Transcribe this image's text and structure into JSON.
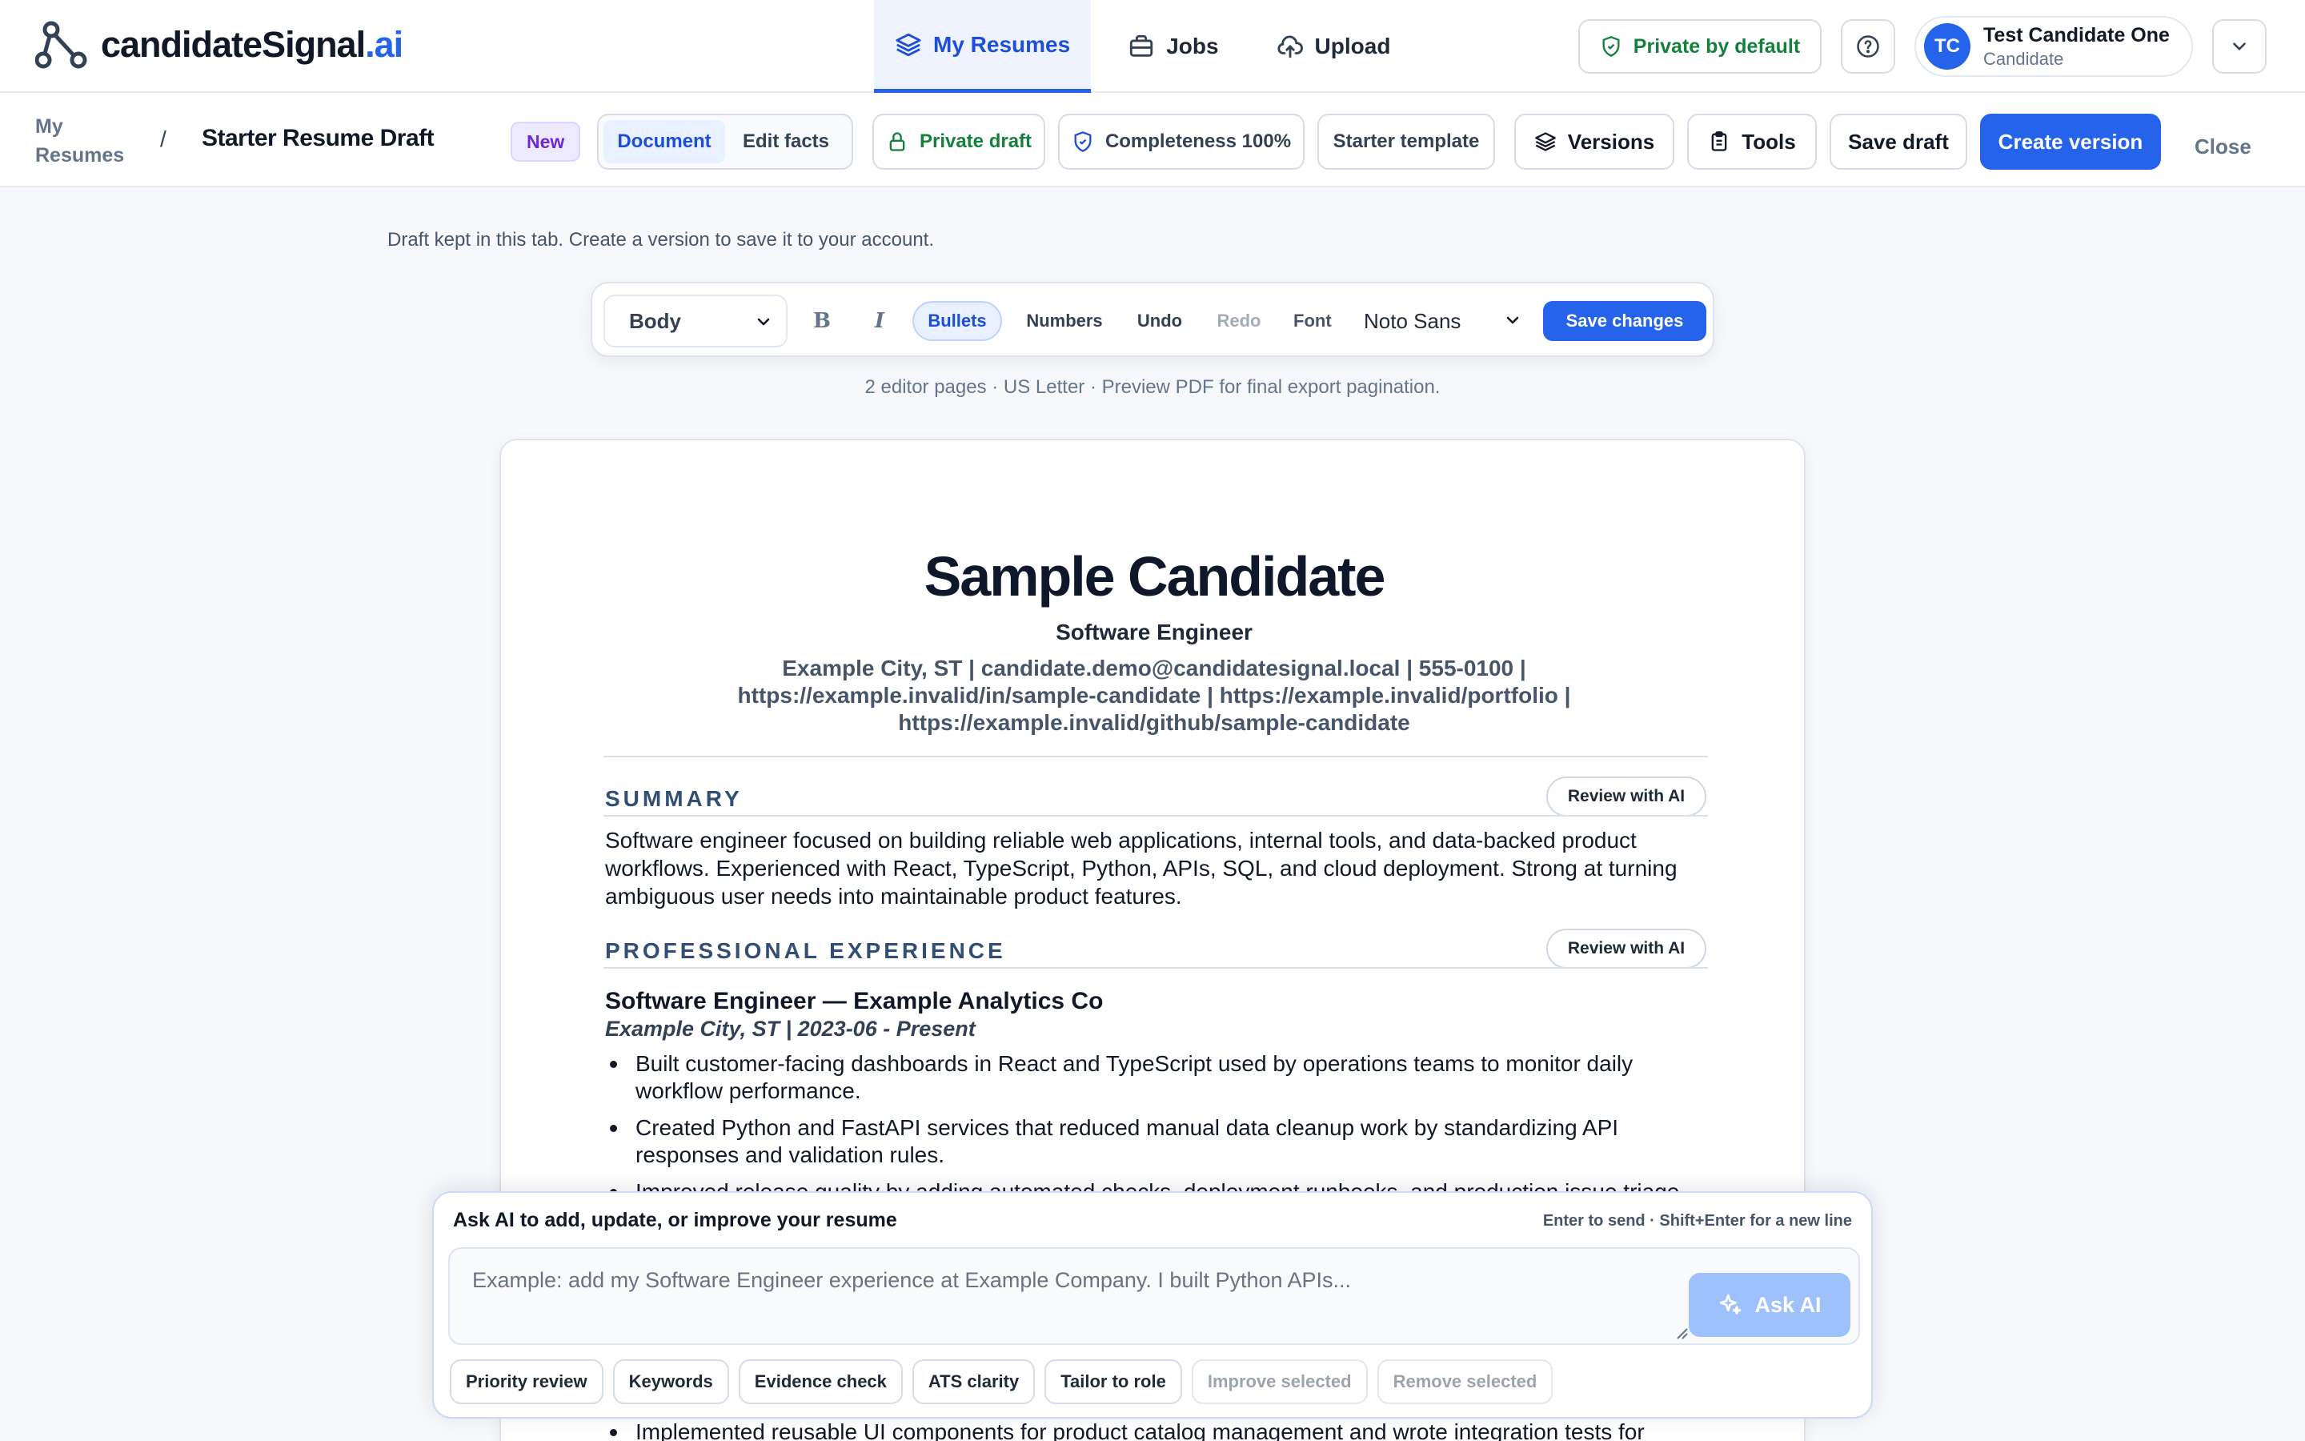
{
  "brand": {
    "name": "candidateSignal",
    "suffix": ".ai"
  },
  "nav": {
    "tabs": [
      {
        "label": "My Resumes",
        "icon": "layers-icon",
        "active": true
      },
      {
        "label": "Jobs",
        "icon": "briefcase-icon",
        "active": false
      },
      {
        "label": "Upload",
        "icon": "cloud-upload-icon",
        "active": false
      }
    ],
    "privacy_label": "Private by default",
    "help_icon": "help-circle-icon"
  },
  "user": {
    "initials": "TC",
    "name": "Test Candidate One",
    "role": "Candidate"
  },
  "toolbar": {
    "breadcrumb_root": "My Resumes",
    "breadcrumb_sep": "/",
    "title": "Starter Resume Draft",
    "badge": "New",
    "view_modes": [
      "Document",
      "Edit facts"
    ],
    "active_view": "Document",
    "private_draft": "Private draft",
    "completeness": "Completeness 100%",
    "template": "Starter template",
    "versions": "Versions",
    "tools": "Tools",
    "save_draft": "Save draft",
    "create_version": "Create version",
    "close": "Close"
  },
  "draft_note": "Draft kept in this tab. Create a version to save it to your account.",
  "editor": {
    "style_value": "Body",
    "bold": "B",
    "italic": "I",
    "bullets": "Bullets",
    "numbers": "Numbers",
    "undo": "Undo",
    "redo": "Redo",
    "font_label": "Font",
    "font_value": "Noto Sans",
    "save_changes": "Save changes"
  },
  "pages_note": "2 editor pages · US Letter · Preview PDF for final export pagination.",
  "resume": {
    "name": "Sample Candidate",
    "role": "Software Engineer",
    "contact_line1": "Example City, ST | candidate.demo@candidatesignal.local | 555-0100 |",
    "contact_line2": "https://example.invalid/in/sample-candidate | https://example.invalid/portfolio |",
    "contact_line3": "https://example.invalid/github/sample-candidate",
    "review_label": "Review with AI",
    "summary_title": "SUMMARY",
    "summary_text": "Software engineer focused on building reliable web applications, internal tools, and data-backed product workflows. Experienced with React, TypeScript, Python, APIs, SQL, and cloud deployment. Strong at turning ambiguous user needs into maintainable product features.",
    "experience_title": "PROFESSIONAL EXPERIENCE",
    "job_title": "Software Engineer — Example Analytics Co",
    "job_meta": "Example City, ST | 2023-06 - Present",
    "bullets": [
      "Built customer-facing dashboards in React and TypeScript used by operations teams to monitor daily workflow performance.",
      "Created Python and FastAPI services that reduced manual data cleanup work by standardizing API responses and validation rules.",
      "Improved release quality by adding automated checks, deployment runbooks, and production issue triage.",
      "Implemented reusable UI components for product catalog management and wrote integration tests for"
    ]
  },
  "ai": {
    "title": "Ask AI to add, update, or improve your resume",
    "hint": "Enter to send · Shift+Enter for a new line",
    "placeholder": "Example: add my Software Engineer experience at Example Company. I built Python APIs...",
    "ask_label": "Ask AI",
    "chips": [
      {
        "label": "Priority review",
        "disabled": false
      },
      {
        "label": "Keywords",
        "disabled": false
      },
      {
        "label": "Evidence check",
        "disabled": false
      },
      {
        "label": "ATS clarity",
        "disabled": false
      },
      {
        "label": "Tailor to role",
        "disabled": false
      },
      {
        "label": "Improve selected",
        "disabled": true
      },
      {
        "label": "Remove selected",
        "disabled": true
      }
    ]
  },
  "colors": {
    "accent": "#2563eb",
    "success": "#15803d",
    "section_heading": "#334e74",
    "badge": "#6d28d9"
  }
}
